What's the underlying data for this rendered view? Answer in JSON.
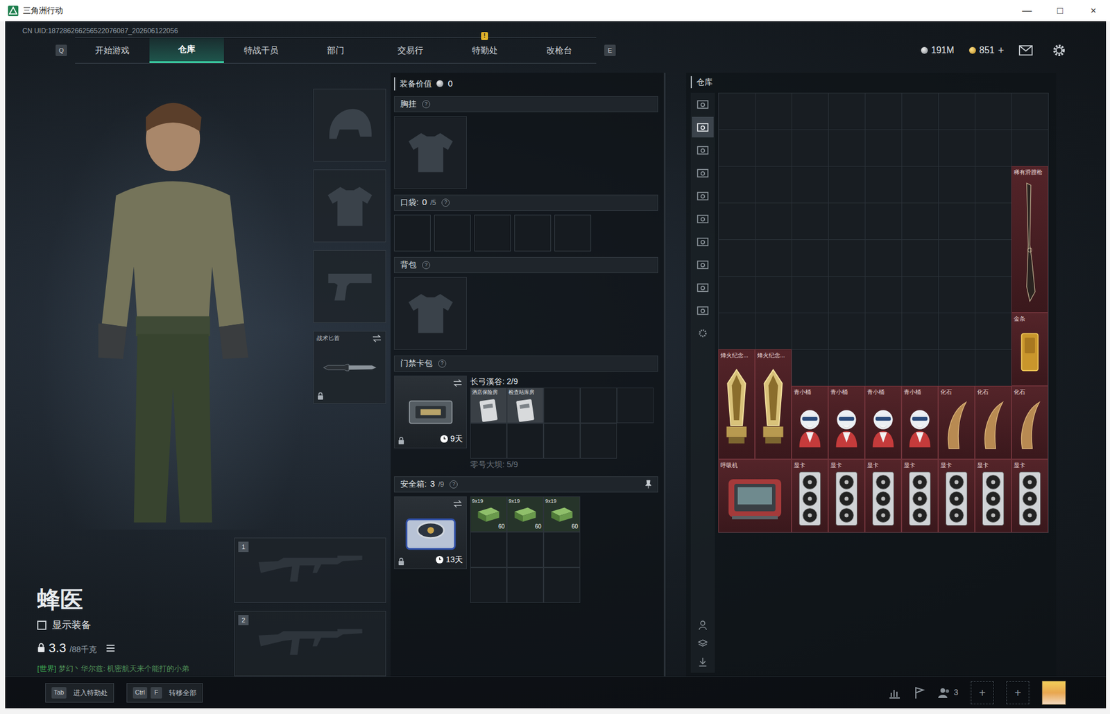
{
  "window": {
    "title": "三角洲行动",
    "controls": [
      "—",
      "□",
      "×"
    ]
  },
  "uid": "CN UID:187286266256522076087_202606122056",
  "nav": {
    "prev_key": "Q",
    "next_key": "E",
    "tabs": [
      {
        "label": "开始游戏",
        "selected": false
      },
      {
        "label": "仓库",
        "selected": true
      },
      {
        "label": "特战干员",
        "selected": false
      },
      {
        "label": "部门",
        "selected": false
      },
      {
        "label": "交易行",
        "selected": false
      },
      {
        "label": "特勤处",
        "selected": false,
        "badge": "!"
      },
      {
        "label": "改枪台",
        "selected": false
      }
    ],
    "currencies": [
      {
        "kind": "silver",
        "value": "191M"
      },
      {
        "kind": "gold",
        "value": "851",
        "action": "+"
      }
    ]
  },
  "operator": {
    "name": "蜂医",
    "show_equipment": {
      "label": "显示装备",
      "checked": false
    },
    "weight": "3.3",
    "weight_max": "/88千克"
  },
  "chat": {
    "channel": "[世界]",
    "text": "梦幻丶华尔兹: 机密航天来个能打的小弟"
  },
  "equipment": [
    {
      "kind": "helmet"
    },
    {
      "kind": "armor"
    },
    {
      "kind": "pistol"
    },
    {
      "kind": "knife",
      "label": "战术匕首",
      "locked": true
    }
  ],
  "weapon_slots": [
    "1",
    "2"
  ],
  "loadout": {
    "value_label": "装备价值",
    "value": "0",
    "chest": {
      "label": "胸挂",
      "help": "?"
    },
    "pockets": {
      "label": "口袋:",
      "count": "0",
      "capacity": "/5",
      "help": "?",
      "slots": 5
    },
    "backpack": {
      "label": "背包",
      "help": "?"
    },
    "keycase": {
      "label": "门禁卡包",
      "help": "?",
      "timer": "9天",
      "locked": true,
      "maps": [
        {
          "title": "长弓溪谷: 2/9",
          "active": true,
          "cards": [
            "酒店保险房",
            "检查站库房"
          ],
          "cells": 9
        },
        {
          "title": "零号大坝: 5/9",
          "active": false
        }
      ]
    },
    "safebox": {
      "label": "安全箱:",
      "count": "3",
      "capacity": "/9",
      "help": "?",
      "timer": "13天",
      "locked": true,
      "cells": 9,
      "items": [
        {
          "name": "9x19",
          "count": "60"
        },
        {
          "name": "9x19",
          "count": "60"
        },
        {
          "name": "9x19",
          "count": "60"
        }
      ]
    }
  },
  "storage": {
    "title": "仓库",
    "tabs": [
      {
        "selected": false
      },
      {
        "selected": true
      },
      {
        "selected": false
      },
      {
        "selected": false
      },
      {
        "selected": false
      },
      {
        "selected": false
      },
      {
        "selected": false
      },
      {
        "selected": false
      },
      {
        "selected": false
      },
      {
        "selected": false
      }
    ],
    "items": [
      {
        "name": "稀有滑膛枪",
        "kind": "rifle"
      },
      {
        "name": "金条",
        "kind": "gold"
      },
      {
        "name": "烽火纪念...",
        "kind": "trophy"
      },
      {
        "name": "烽火纪念...",
        "kind": "trophy"
      },
      {
        "name": "青小桶",
        "kind": "bust"
      },
      {
        "name": "青小桶",
        "kind": "bust"
      },
      {
        "name": "青小桶",
        "kind": "bust"
      },
      {
        "name": "青小桶",
        "kind": "bust"
      },
      {
        "name": "化石",
        "kind": "fossil"
      },
      {
        "name": "化石",
        "kind": "fossil"
      },
      {
        "name": "化石",
        "kind": "fossil"
      },
      {
        "name": "呼吸机",
        "kind": "ventilator"
      },
      {
        "name": "显卡",
        "kind": "gpu"
      },
      {
        "name": "显卡",
        "kind": "gpu"
      },
      {
        "name": "显卡",
        "kind": "gpu"
      },
      {
        "name": "显卡",
        "kind": "gpu"
      },
      {
        "name": "显卡",
        "kind": "gpu"
      },
      {
        "name": "显卡",
        "kind": "gpu"
      },
      {
        "name": "显卡",
        "kind": "gpu"
      }
    ]
  },
  "bottom": {
    "hints": [
      {
        "keys": [
          "Tab"
        ],
        "label": "进入特勤处"
      },
      {
        "keys": [
          "Ctrl",
          "F"
        ],
        "label": "转移全部"
      }
    ],
    "friends": "3",
    "party_slots": [
      "+",
      "+"
    ]
  }
}
